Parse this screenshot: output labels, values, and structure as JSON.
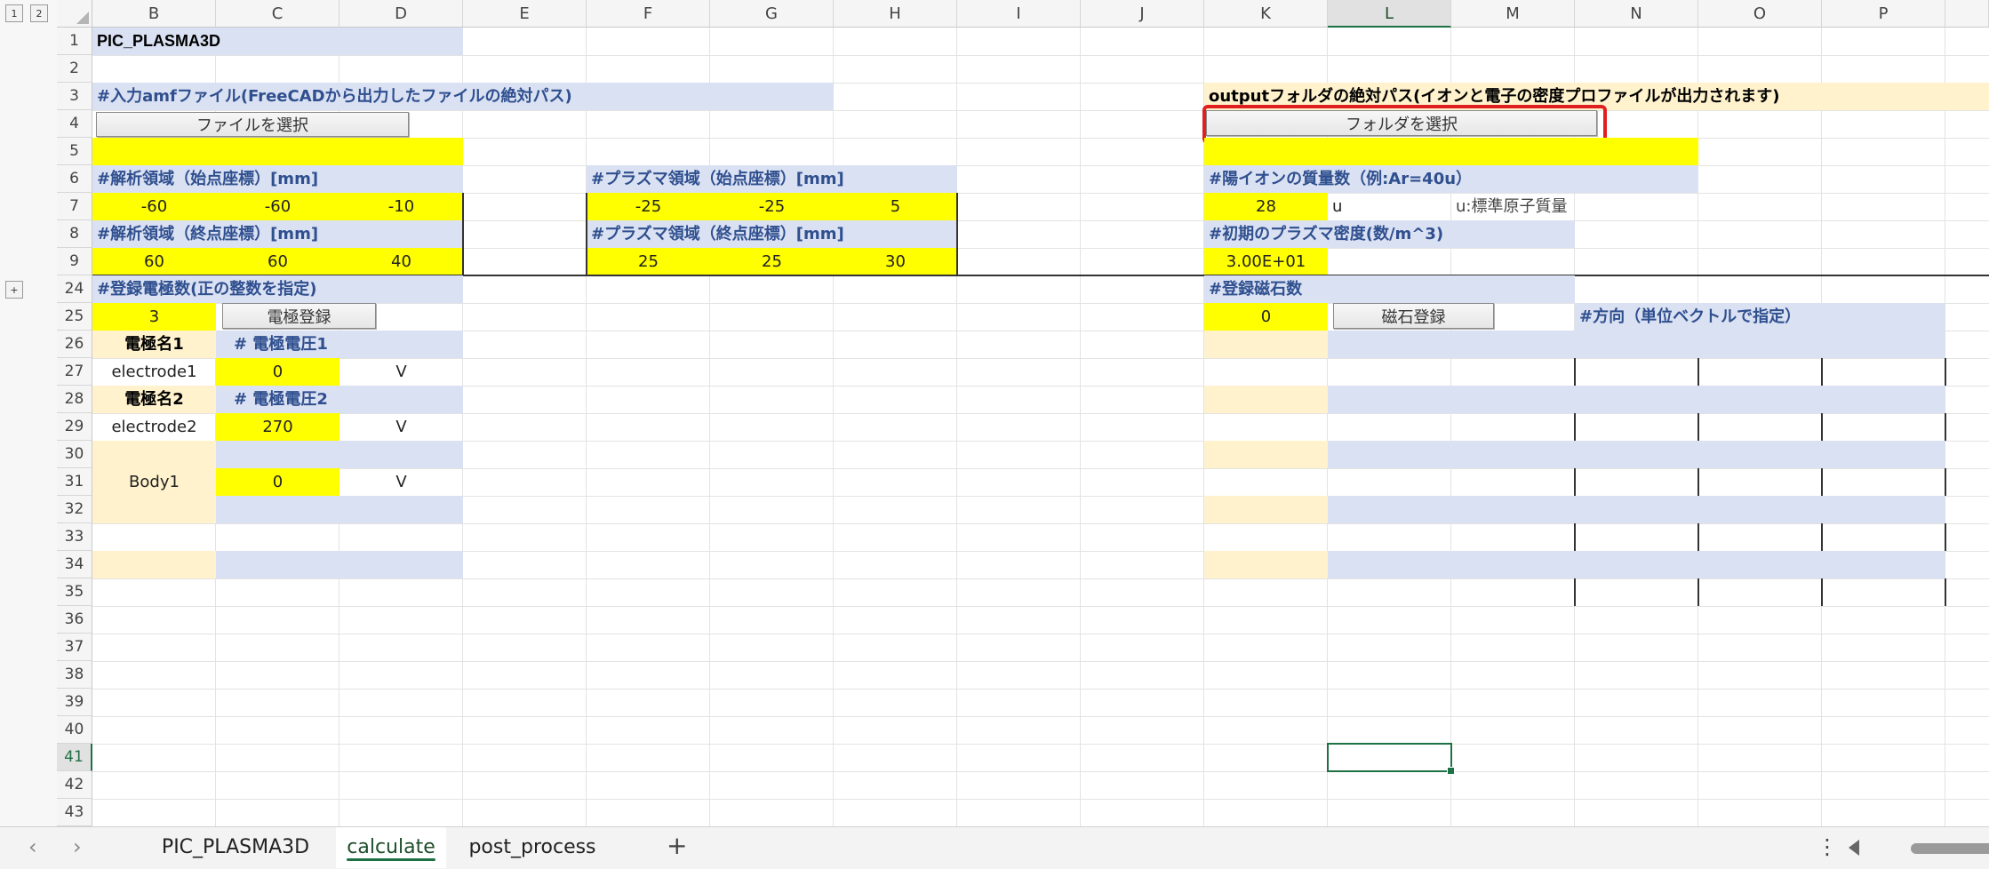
{
  "outline": {
    "level1": "1",
    "level2": "2",
    "expand": "+"
  },
  "columns": [
    "B",
    "C",
    "D",
    "E",
    "F",
    "G",
    "H",
    "I",
    "J",
    "K",
    "L",
    "M",
    "N",
    "O",
    "P"
  ],
  "rows": [
    "1",
    "2",
    "3",
    "4",
    "5",
    "6",
    "7",
    "8",
    "9",
    "24",
    "25",
    "26",
    "27",
    "28",
    "29",
    "30",
    "31",
    "32",
    "33",
    "34",
    "35",
    "36",
    "37",
    "38",
    "39",
    "40",
    "41",
    "42",
    "43"
  ],
  "cells": {
    "title": "PIC_PLASMA3D",
    "input_label": "#入力amfファイル(FreeCADから出力したファイルの絶対パス)",
    "select_file_button": "ファイルを選択",
    "output_label": "outputフォルダの絶対パス(イオンと電子の密度プロファイルが出力されます)",
    "select_folder_button": "フォルダを選択",
    "analysis_start_label": "#解析領域（始点座標）[mm]",
    "analysis_start": [
      "-60",
      "-60",
      "-10"
    ],
    "analysis_end_label": "#解析領域（終点座標）[mm]",
    "analysis_end": [
      "60",
      "60",
      "40"
    ],
    "plasma_start_label": "#プラズマ領域（始点座標）[mm]",
    "plasma_start": [
      "-25",
      "-25",
      "5"
    ],
    "plasma_end_label": "#プラズマ領域（終点座標）[mm]",
    "plasma_end": [
      "25",
      "25",
      "30"
    ],
    "ion_mass_label": "#陽イオンの質量数（例:Ar=40u）",
    "ion_mass_value": "28",
    "ion_mass_unit": "u",
    "ion_mass_note": "u:標準原子質量",
    "plasma_density_label": "#初期のプラズマ密度(数/m^3)",
    "plasma_density_value": "3.00E+01",
    "electrode_count_label": "#登録電極数(正の整数を指定)",
    "electrode_count_value": "3",
    "register_electrode_button": "電極登録",
    "electrode1_name_label": "電極名1",
    "electrode1_voltage_label": "# 電極電圧1",
    "electrode1_name": "electrode1",
    "electrode1_voltage": "0",
    "electrode1_unit": "V",
    "electrode2_name_label": "電極名2",
    "electrode2_voltage_label": "# 電極電圧2",
    "electrode2_name": "electrode2",
    "electrode2_voltage": "270",
    "electrode2_unit": "V",
    "body1_name": "Body1",
    "body1_voltage": "0",
    "body1_unit": "V",
    "magnet_count_label": "#登録磁石数",
    "magnet_count_value": "0",
    "register_magnet_button": "磁石登録",
    "direction_label": "#方向（単位ベクトルで指定）"
  },
  "tabs": [
    {
      "label": "PIC_PLASMA3D",
      "active": false
    },
    {
      "label": "calculate",
      "active": true
    },
    {
      "label": "post_process",
      "active": false
    }
  ],
  "tabbar": {
    "prev": "‹",
    "next": "›",
    "add": "+",
    "more": "⋮"
  },
  "colors": {
    "yellow": "#ffff00",
    "label_bg": "#dae1f2",
    "name_bg": "#fff2cc",
    "accent": "#1e7145",
    "highlight": "#e02020"
  }
}
